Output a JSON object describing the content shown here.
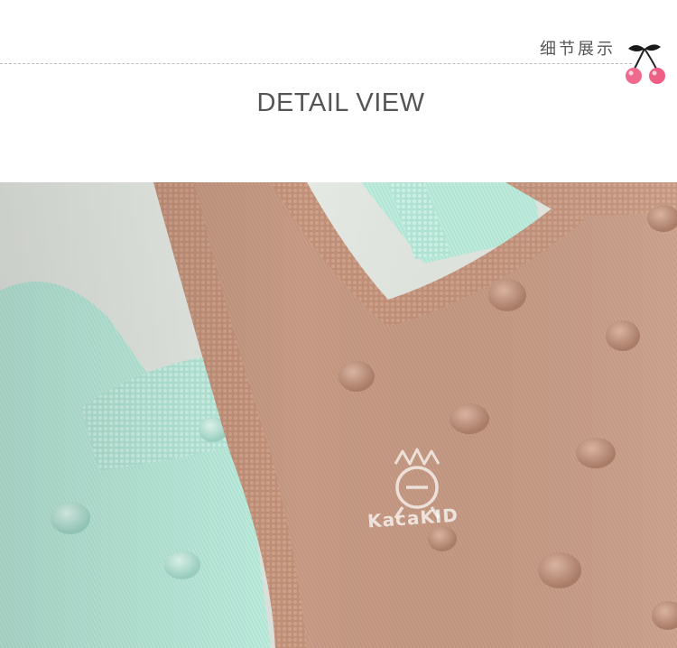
{
  "header": {
    "cn_label": "细节展示",
    "title": "DETAIL VIEW"
  },
  "photo": {
    "watermark_brand": "KacaKID"
  },
  "colors": {
    "rule": "#bdbdbd",
    "title_text": "#555555",
    "cherry": "#f06a8f",
    "knit_pink": "#c89d86",
    "knit_mint": "#b8ecdc"
  },
  "icons": [
    "cherry-icon",
    "crown-logo-icon"
  ]
}
